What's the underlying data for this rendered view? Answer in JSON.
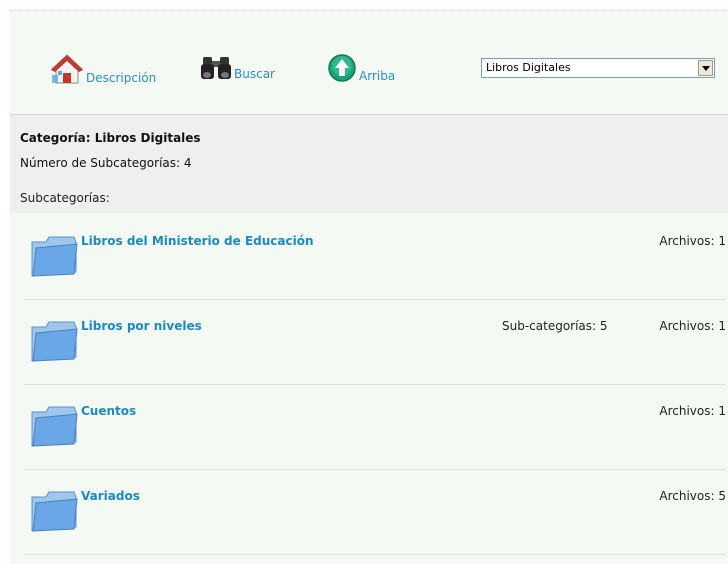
{
  "toolbar": {
    "description_label": "Descripción",
    "search_label": "Buscar",
    "up_label": "Arriba",
    "category_select_value": "Libros Digitales"
  },
  "category": {
    "title": "Categoría: Libros Digitales",
    "subcategory_count": "Número de Subcategorías: 4"
  },
  "subcategories_header": "Subcategorías:",
  "subcategories": [
    {
      "name": "Libros del Ministerio de Educación",
      "subs": "",
      "files": "Archivos: 1"
    },
    {
      "name": "Libros por niveles",
      "subs": "Sub-categorías: 5",
      "files": "Archivos: 1"
    },
    {
      "name": "Cuentos",
      "subs": "",
      "files": "Archivos: 1"
    },
    {
      "name": "Variados",
      "subs": "",
      "files": "Archivos: 5"
    }
  ],
  "colors": {
    "link": "#1a8ac6",
    "background": "#f4faf3",
    "panel": "#efefef"
  },
  "icons": {
    "description": "house-icon",
    "search": "binoculars-icon",
    "up": "up-arrow-circle-icon",
    "folder": "folder-icon"
  }
}
